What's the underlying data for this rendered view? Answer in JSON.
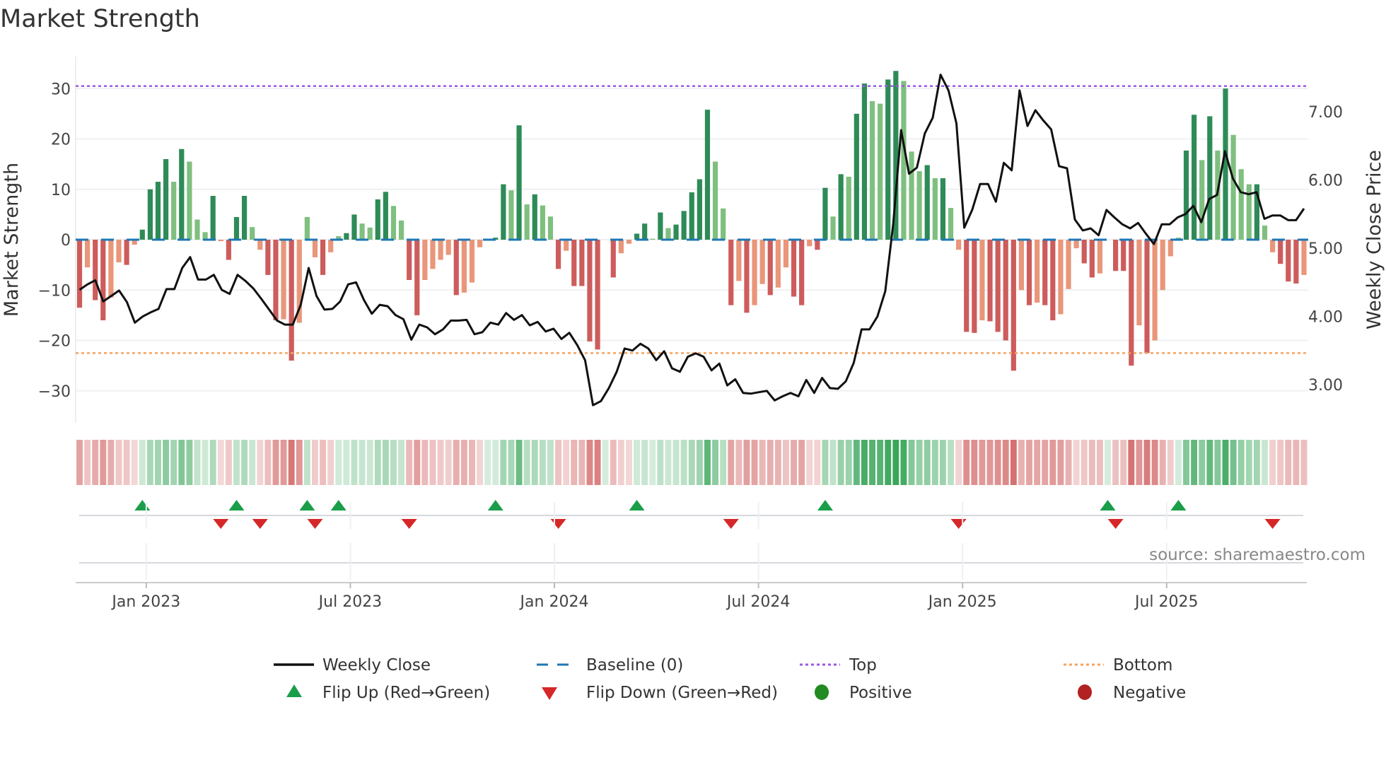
{
  "chart_data": {
    "type": "bar",
    "title": "Market Strength",
    "ylabel": "Market Strength",
    "y2label": "Weekly Close Price",
    "ylim": [
      -36,
      36
    ],
    "y2lim": [
      2.45,
      7.8
    ],
    "yticks": [
      30,
      20,
      10,
      0,
      -10,
      -20,
      -30
    ],
    "ytick_labels": [
      "30",
      "20",
      "10",
      "0",
      "−10",
      "−20",
      "−30"
    ],
    "y2ticks": [
      7,
      6,
      5,
      4,
      3
    ],
    "y2tick_labels": [
      "7.00",
      "6.00",
      "5.00",
      "4.00",
      "3.00"
    ],
    "xtick_labels": [
      "Jan 2023",
      "Jul 2023",
      "Jan 2024",
      "Jul 2024",
      "Jan 2025",
      "Jul 2025"
    ],
    "xtick_week_index": [
      9,
      35,
      61,
      87,
      113,
      139
    ],
    "top_level": 30.5,
    "bottom_level": -22.5,
    "strength": [
      -13.5,
      -5.5,
      -12,
      -16,
      -11.5,
      -4.5,
      -5,
      -1,
      2,
      10,
      11.5,
      16,
      11.5,
      18,
      15.5,
      4,
      1.5,
      8.7,
      -0.3,
      -4,
      4.5,
      8.7,
      2.5,
      -2,
      -7,
      -16,
      -15.8,
      -24,
      -16.5,
      4.5,
      -3.5,
      -7,
      -2.5,
      0.7,
      1.3,
      5,
      3.2,
      2.4,
      8,
      9.5,
      6.7,
      3.8,
      -8,
      -15,
      -8,
      -5.8,
      -4,
      -3,
      -11,
      -10.5,
      -8.5,
      -1.5,
      0,
      0.4,
      11,
      9.8,
      22.7,
      7,
      9,
      6.8,
      4.6,
      -5.8,
      -2.2,
      -9.2,
      -9.2,
      -20.2,
      -21.8,
      0,
      -7.5,
      -2.7,
      -0.8,
      1.2,
      3.2,
      0.2,
      5.4,
      2.3,
      3,
      5.7,
      9.4,
      12,
      25.8,
      15.5,
      6.2,
      -13,
      -8.2,
      -14.5,
      -13,
      -8.8,
      -11,
      -9.5,
      -5.5,
      -11.3,
      -13,
      -1.3,
      -2,
      10.3,
      4.6,
      13,
      12.5,
      25,
      31,
      27.5,
      27,
      31.8,
      33.5,
      31.5,
      17.5,
      13.6,
      14.8,
      12.2,
      12.2,
      6.3,
      -2,
      -18.3,
      -18.5,
      -16,
      -16.2,
      -18.3,
      -20,
      -26,
      -10,
      -13,
      -12.5,
      -13,
      -16,
      -14.8,
      -9.8,
      -1.7,
      -4.7,
      -7.5,
      -6.7,
      0,
      -6.2,
      -6.2,
      -25,
      -17,
      -22.5,
      -20,
      -10,
      -3.3,
      0.4,
      17.7,
      24.8,
      15.8,
      24.5,
      17.7,
      30,
      20.8,
      14,
      11,
      11,
      2.8,
      -2.5,
      -4.8,
      -8.3,
      -8.7,
      -7
    ],
    "weekly_close": [
      4.39,
      4.47,
      4.53,
      4.22,
      4.3,
      4.38,
      4.21,
      3.91,
      4.0,
      4.06,
      4.11,
      4.4,
      4.4,
      4.71,
      4.87,
      4.54,
      4.54,
      4.61,
      4.39,
      4.33,
      4.61,
      4.52,
      4.41,
      4.26,
      4.1,
      3.94,
      3.88,
      3.88,
      4.17,
      4.71,
      4.3,
      4.1,
      4.11,
      4.22,
      4.47,
      4.5,
      4.24,
      4.04,
      4.17,
      4.15,
      4.02,
      3.96,
      3.66,
      3.88,
      3.84,
      3.74,
      3.81,
      3.94,
      3.94,
      3.95,
      3.74,
      3.77,
      3.91,
      3.88,
      4.05,
      3.95,
      4.02,
      3.87,
      3.92,
      3.78,
      3.82,
      3.67,
      3.76,
      3.58,
      3.36,
      2.7,
      2.76,
      2.95,
      3.19,
      3.53,
      3.5,
      3.6,
      3.53,
      3.36,
      3.49,
      3.24,
      3.19,
      3.41,
      3.46,
      3.41,
      3.21,
      3.31,
      2.99,
      3.08,
      2.88,
      2.87,
      2.89,
      2.91,
      2.77,
      2.83,
      2.88,
      2.83,
      3.07,
      2.88,
      3.1,
      2.95,
      2.94,
      3.05,
      3.32,
      3.81,
      3.81,
      4.0,
      4.37,
      5.35,
      6.73,
      6.09,
      6.18,
      6.68,
      6.91,
      7.54,
      7.31,
      6.83,
      5.3,
      5.56,
      5.94,
      5.94,
      5.68,
      6.25,
      6.14,
      7.31,
      6.79,
      7.02,
      6.87,
      6.74,
      6.2,
      6.17,
      5.42,
      5.26,
      5.29,
      5.19,
      5.56,
      5.45,
      5.35,
      5.29,
      5.37,
      5.21,
      5.06,
      5.35,
      5.35,
      5.45,
      5.5,
      5.62,
      5.38,
      5.72,
      5.78,
      6.42,
      6.02,
      5.82,
      5.79,
      5.82,
      5.43,
      5.48,
      5.48,
      5.41,
      5.41,
      5.58
    ],
    "flip_up_week_index": [
      8,
      20,
      29,
      33,
      53,
      71,
      95,
      131,
      140
    ],
    "flip_down_week_index": [
      18,
      23,
      30,
      42,
      61,
      83,
      112,
      132,
      152
    ],
    "legend": {
      "weekly_close": "Weekly Close",
      "baseline": "Baseline (0)",
      "top": "Top",
      "bottom": "Bottom",
      "flip_up": "Flip Up (Red→Green)",
      "flip_down": "Flip Down (Green→Red)",
      "positive": "Positive",
      "negative": "Negative"
    },
    "legend_placement": "bottom",
    "source": "source: sharemaestro.com",
    "colors": {
      "strong_green": "#2e8b57",
      "weak_green": "#7fbf7f",
      "strong_red": "#cd5c5c",
      "weak_red": "#e9967a",
      "baseline": "#1f77b4",
      "top": "#9b59e0",
      "bottom": "#f4a460",
      "line": "#111111",
      "flip_up": "#1a9e4a",
      "flip_down": "#d62728",
      "positive": "#228b22",
      "negative": "#b22222"
    }
  }
}
